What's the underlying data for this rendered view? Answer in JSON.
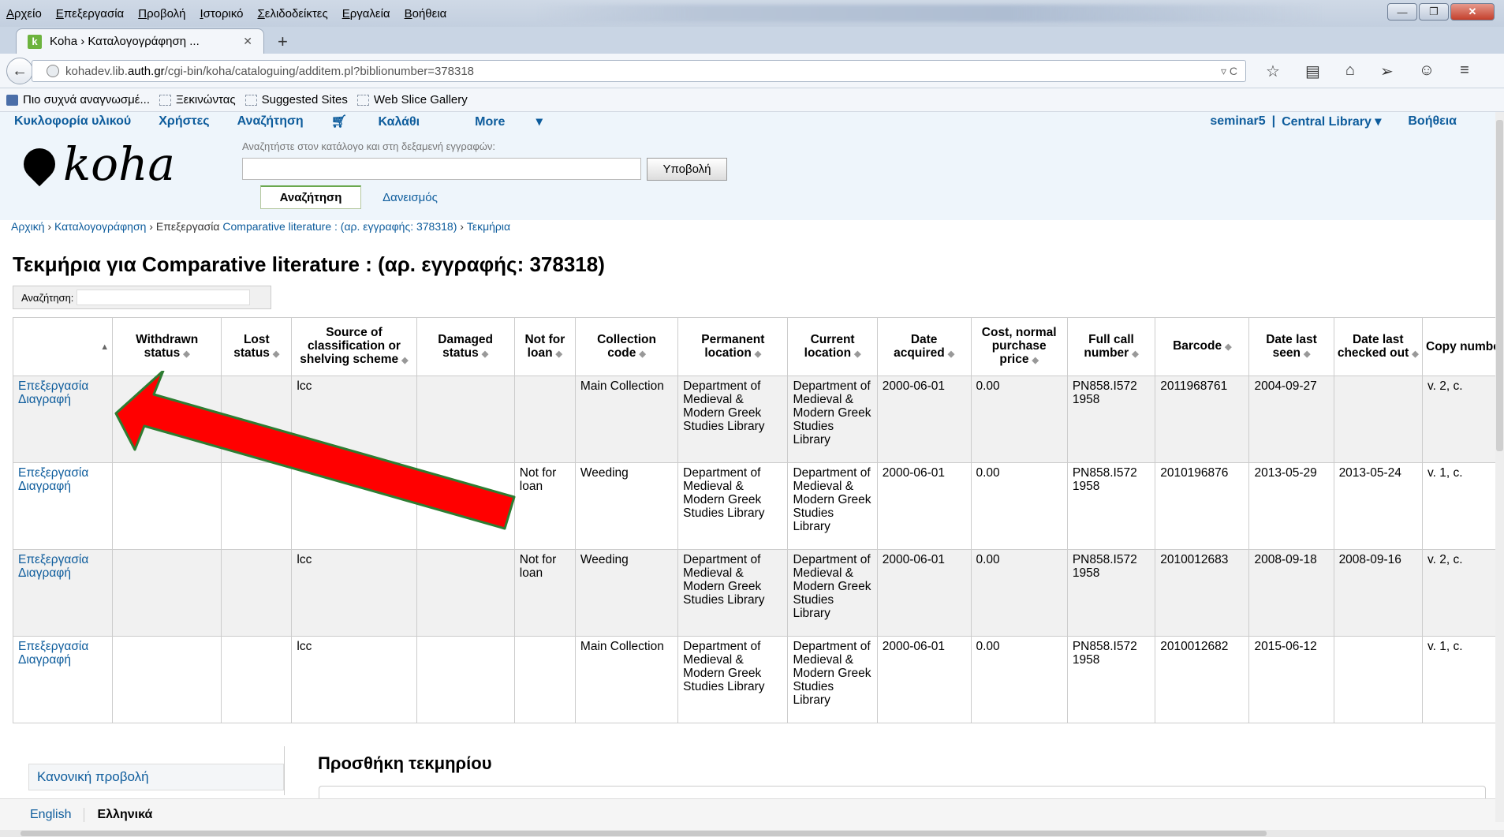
{
  "browser": {
    "menu": [
      "Αρχείο",
      "Επεξεργασία",
      "Προβολή",
      "Ιστορικό",
      "Σελιδοδείκτες",
      "Εργαλεία",
      "Βοήθεια"
    ],
    "tab_title": "Koha › Καταλογογράφηση ...",
    "url_host_pre": "kohadev.lib.",
    "url_host_bold": "auth.gr",
    "url_path": "/cgi-bin/koha/cataloguing/additem.pl?biblionumber=378318",
    "bookmarks": [
      "Πιο συχνά αναγνωσμέ...",
      "Ξεκινώντας",
      "Suggested Sites",
      "Web Slice Gallery"
    ]
  },
  "koha": {
    "nav": [
      "Κυκλοφορία υλικού",
      "Χρήστες",
      "Αναζήτηση",
      "Καλάθι",
      "More"
    ],
    "user": "seminar5",
    "branch": "Central Library",
    "help": "Βοήθεια",
    "logo_text": "koha",
    "search_hint": "Αναζητήστε στον κατάλογο και στη δεξαμενή εγγραφών:",
    "submit": "Υποβολή",
    "tab_search": "Αναζήτηση",
    "tab_checkout": "Δανεισμός"
  },
  "breadcrumb": {
    "home": "Αρχική",
    "cataloguing": "Καταλογογράφηση",
    "edit": "Επεξεργασία",
    "record": "Comparative literature : (αρ. εγγραφής: 378318)",
    "items": "Τεκμήρια"
  },
  "page_title": "Τεκμήρια για Comparative literature : (αρ. εγγραφής: 378318)",
  "filter_label": "Αναζήτηση:",
  "table": {
    "headers": [
      "",
      "Withdrawn status",
      "Lost status",
      "Source of classification or shelving scheme",
      "Damaged status",
      "Not for loan",
      "Collection code",
      "Permanent location",
      "Current location",
      "Date acquired",
      "Cost, normal purchase price",
      "Full call number",
      "Barcode",
      "Date last seen",
      "Date last checked out",
      "Copy numbe"
    ],
    "rows": [
      {
        "edit": "Επεξεργασία",
        "delete": "Διαγραφή",
        "withdrawn": "",
        "lost": "",
        "source": "lcc",
        "damaged": "",
        "notforloan": "",
        "ccode": "Main Collection",
        "permloc": "Department of Medieval & Modern Greek Studies Library",
        "curloc": "Department of Medieval & Modern Greek Studies Library",
        "acquired": "2000-06-01",
        "cost": "0.00",
        "callnum": "PN858.I572 1958",
        "barcode": "2011968761",
        "lastseen": "2004-09-27",
        "lastout": "",
        "copy": "v. 2, c."
      },
      {
        "edit": "Επεξεργασία",
        "delete": "Διαγραφή",
        "withdrawn": "",
        "lost": "",
        "source": "",
        "damaged": "",
        "notforloan": "Not for loan",
        "ccode": "Weeding",
        "permloc": "Department of Medieval & Modern Greek Studies Library",
        "curloc": "Department of Medieval & Modern Greek Studies Library",
        "acquired": "2000-06-01",
        "cost": "0.00",
        "callnum": "PN858.I572 1958",
        "barcode": "2010196876",
        "lastseen": "2013-05-29",
        "lastout": "2013-05-24",
        "copy": "v. 1, c."
      },
      {
        "edit": "Επεξεργασία",
        "delete": "Διαγραφή",
        "withdrawn": "",
        "lost": "",
        "source": "lcc",
        "damaged": "",
        "notforloan": "Not for loan",
        "ccode": "Weeding",
        "permloc": "Department of Medieval & Modern Greek Studies Library",
        "curloc": "Department of Medieval & Modern Greek Studies Library",
        "acquired": "2000-06-01",
        "cost": "0.00",
        "callnum": "PN858.I572 1958",
        "barcode": "2010012683",
        "lastseen": "2008-09-18",
        "lastout": "2008-09-16",
        "copy": "v. 2, c."
      },
      {
        "edit": "Επεξεργασία",
        "delete": "Διαγραφή",
        "withdrawn": "",
        "lost": "",
        "source": "lcc",
        "damaged": "",
        "notforloan": "",
        "ccode": "Main Collection",
        "permloc": "Department of Medieval & Modern Greek Studies Library",
        "curloc": "Department of Medieval & Modern Greek Studies Library",
        "acquired": "2000-06-01",
        "cost": "0.00",
        "callnum": "PN858.I572 1958",
        "barcode": "2010012682",
        "lastseen": "2015-06-12",
        "lastout": "",
        "copy": "v. 1, c."
      }
    ]
  },
  "sidebar_link": "Κανονική προβολή",
  "add_item_title": "Προσθήκη τεκμηρίου",
  "languages": {
    "english": "English",
    "greek": "Ελληνικά"
  },
  "annotation": {
    "arrow_color": "#ff0000",
    "arrow_outline": "#2e7d32"
  }
}
